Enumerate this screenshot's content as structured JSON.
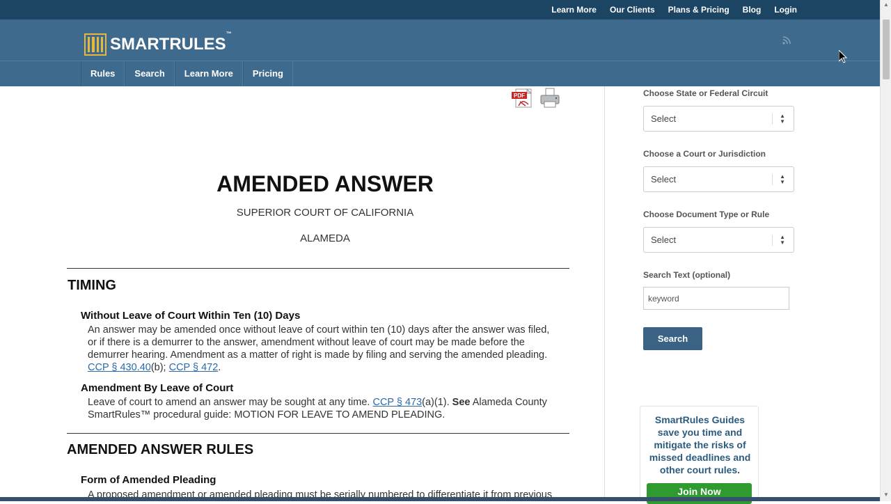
{
  "top_links": [
    "Learn More",
    "Our Clients",
    "Plans & Pricing",
    "Blog",
    "Login"
  ],
  "brand": {
    "name": "SMARTRULES",
    "tm": "™"
  },
  "nav": [
    "Rules",
    "Search",
    "Learn More",
    "Pricing"
  ],
  "document": {
    "title": "AMENDED ANSWER",
    "court": "SUPERIOR COURT OF CALIFORNIA",
    "county": "ALAMEDA",
    "section_timing": "TIMING",
    "sub1": "Without Leave of Court Within Ten (10) Days",
    "p1_text": "An answer may be amended once without leave of court within ten (10) days after the answer was filed, or if there is a demurrer to the answer, amendment without leave of court may be made before the demurrer hearing. Amendment as a matter of right is made by filing and serving the amended pleading.",
    "p1_link1": "CCP § 430.40",
    "p1_mid": "(b);",
    "p1_link2": "CCP § 472",
    "p1_end": ".",
    "sub2": "Amendment By Leave of Court",
    "p2_text": "Leave of court to amend an answer may be sought at any time.",
    "p2_link": "CCP § 473",
    "p2_mid": "(a)(1).",
    "p2_see": "See",
    "p2_rest": "Alameda County SmartRules™ procedural guide: MOTION FOR LEAVE TO AMEND PLEADING.",
    "section_rules": "AMENDED ANSWER RULES",
    "sub3": "Form of Amended Pleading",
    "p3_text": "A proposed amendment or amended pleading must be serially numbered to differentiate it from previous"
  },
  "sidebar": {
    "state_label": "Choose State or Federal Circuit",
    "state_value": "Select",
    "court_label": "Choose a Court or Jurisdiction",
    "court_value": "Select",
    "doc_label": "Choose Document Type or Rule",
    "doc_value": "Select",
    "search_label": "Search Text (optional)",
    "search_placeholder": "keyword",
    "search_button": "Search",
    "promo_text": "SmartRules Guides save you time and mitigate the risks of missed deadlines and other court rules.",
    "promo_button": "Join Now"
  },
  "colors": {
    "topbar": "#1c4563",
    "header": "#3e6a8d",
    "link": "#2a6aa8",
    "join": "#2f9a2f"
  }
}
